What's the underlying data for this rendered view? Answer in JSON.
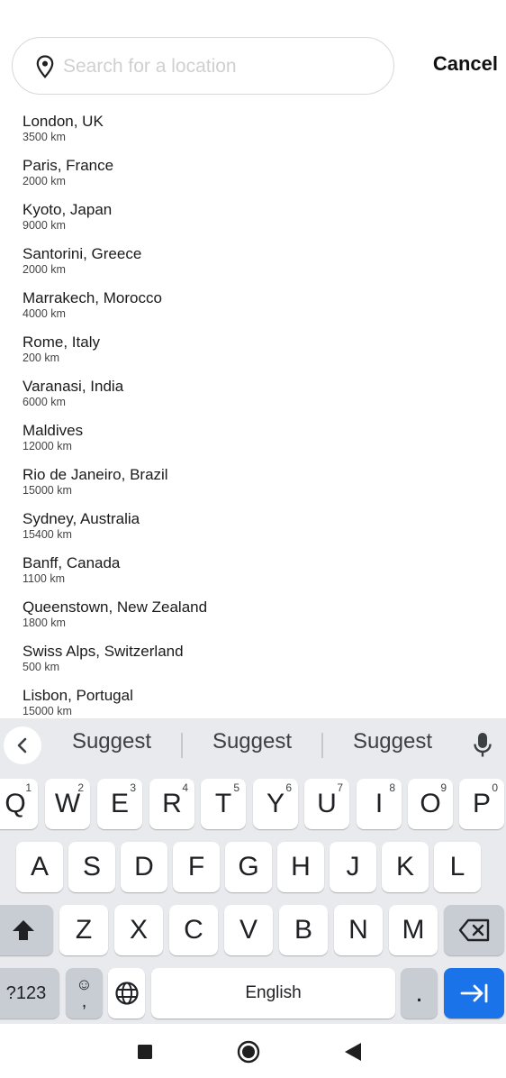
{
  "search": {
    "placeholder": "Search for a location",
    "value": "",
    "cancel_label": "Cancel"
  },
  "results": [
    {
      "name": "London, UK",
      "distance": "3500 km"
    },
    {
      "name": "Paris, France",
      "distance": "2000 km"
    },
    {
      "name": "Kyoto, Japan",
      "distance": "9000 km"
    },
    {
      "name": "Santorini, Greece",
      "distance": "2000 km"
    },
    {
      "name": "Marrakech, Morocco",
      "distance": "4000 km"
    },
    {
      "name": "Rome, Italy",
      "distance": "200 km"
    },
    {
      "name": "Varanasi, India",
      "distance": "6000 km"
    },
    {
      "name": "Maldives",
      "distance": "12000 km"
    },
    {
      "name": "Rio de Janeiro, Brazil",
      "distance": "15000 km"
    },
    {
      "name": "Sydney, Australia",
      "distance": "15400 km"
    },
    {
      "name": "Banff, Canada",
      "distance": "1100 km"
    },
    {
      "name": "Queenstown, New Zealand",
      "distance": "1800 km"
    },
    {
      "name": "Swiss Alps, Switzerland",
      "distance": "500 km"
    },
    {
      "name": "Lisbon, Portugal",
      "distance": "15000 km"
    }
  ],
  "keyboard": {
    "suggestions": [
      "Suggest",
      "Suggest",
      "Suggest"
    ],
    "row1": [
      {
        "key": "Q",
        "hint": "1"
      },
      {
        "key": "W",
        "hint": "2"
      },
      {
        "key": "E",
        "hint": "3"
      },
      {
        "key": "R",
        "hint": "4"
      },
      {
        "key": "T",
        "hint": "5"
      },
      {
        "key": "Y",
        "hint": "6"
      },
      {
        "key": "U",
        "hint": "7"
      },
      {
        "key": "I",
        "hint": "8"
      },
      {
        "key": "O",
        "hint": "9"
      },
      {
        "key": "P",
        "hint": "0"
      }
    ],
    "row2": [
      "A",
      "S",
      "D",
      "F",
      "G",
      "H",
      "J",
      "K",
      "L"
    ],
    "row3": [
      "Z",
      "X",
      "C",
      "V",
      "B",
      "N",
      "M"
    ],
    "symbols_label": "?123",
    "emoji_comma": ",",
    "space_label": "English",
    "period_label": ".",
    "accent_color": "#1a73e8"
  },
  "icons": {
    "search_field": "location-pin-icon",
    "suggestion_back": "chevron-left-icon",
    "voice": "microphone-icon",
    "shift": "shift-arrow-icon",
    "delete": "backspace-icon",
    "emoji": "emoji-icon",
    "language": "globe-icon",
    "action": "tab-arrow-icon",
    "nav_recents": "square-icon",
    "nav_home": "circle-icon",
    "nav_back": "triangle-back-icon"
  }
}
